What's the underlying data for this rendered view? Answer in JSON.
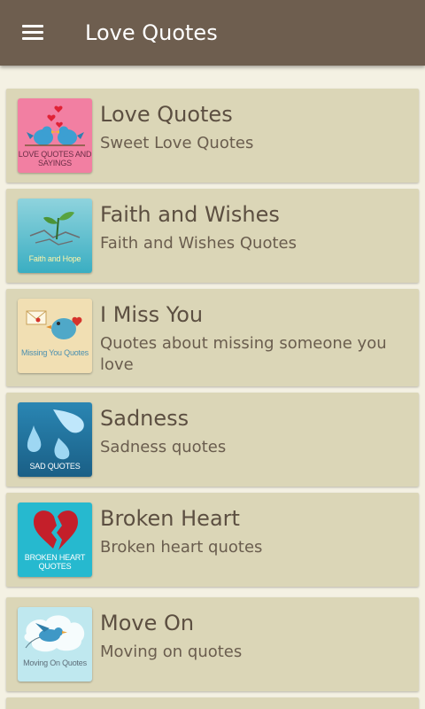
{
  "app_bar": {
    "title": "Love Quotes",
    "menu_icon": "hamburger-menu-icon",
    "background_color": "#6e5e4f"
  },
  "categories": [
    {
      "title": "Love Quotes",
      "subtitle": "Sweet Love Quotes",
      "thumbnail_caption": "LOVE QUOTES AND SAYINGS",
      "thumbnail_icon": "love-birds-hearts-icon",
      "thumbnail_color": "#f27fa2"
    },
    {
      "title": "Faith and Wishes",
      "subtitle": "Faith and Wishes Quotes",
      "thumbnail_caption": "Faith and Hope",
      "thumbnail_icon": "sprout-icon",
      "thumbnail_color": "#3aaec2"
    },
    {
      "title": "I Miss You",
      "subtitle": "Quotes about missing someone you love",
      "thumbnail_caption": "Missing You Quotes",
      "thumbnail_icon": "bird-envelope-icon",
      "thumbnail_color": "#f1dfb3"
    },
    {
      "title": "Sadness",
      "subtitle": "Sadness quotes",
      "thumbnail_caption": "SAD QUOTES",
      "thumbnail_icon": "teardrops-icon",
      "thumbnail_color": "#1e6f98"
    },
    {
      "title": "Broken Heart",
      "subtitle": "Broken heart quotes",
      "thumbnail_caption": "BROKEN HEART QUOTES",
      "thumbnail_icon": "broken-heart-icon",
      "thumbnail_color": "#26b9cf"
    },
    {
      "title": "Move On",
      "subtitle": "Moving on quotes",
      "thumbnail_caption": "Moving On Quotes",
      "thumbnail_icon": "bird-cloud-icon",
      "thumbnail_color": "#bfe8ef"
    }
  ]
}
